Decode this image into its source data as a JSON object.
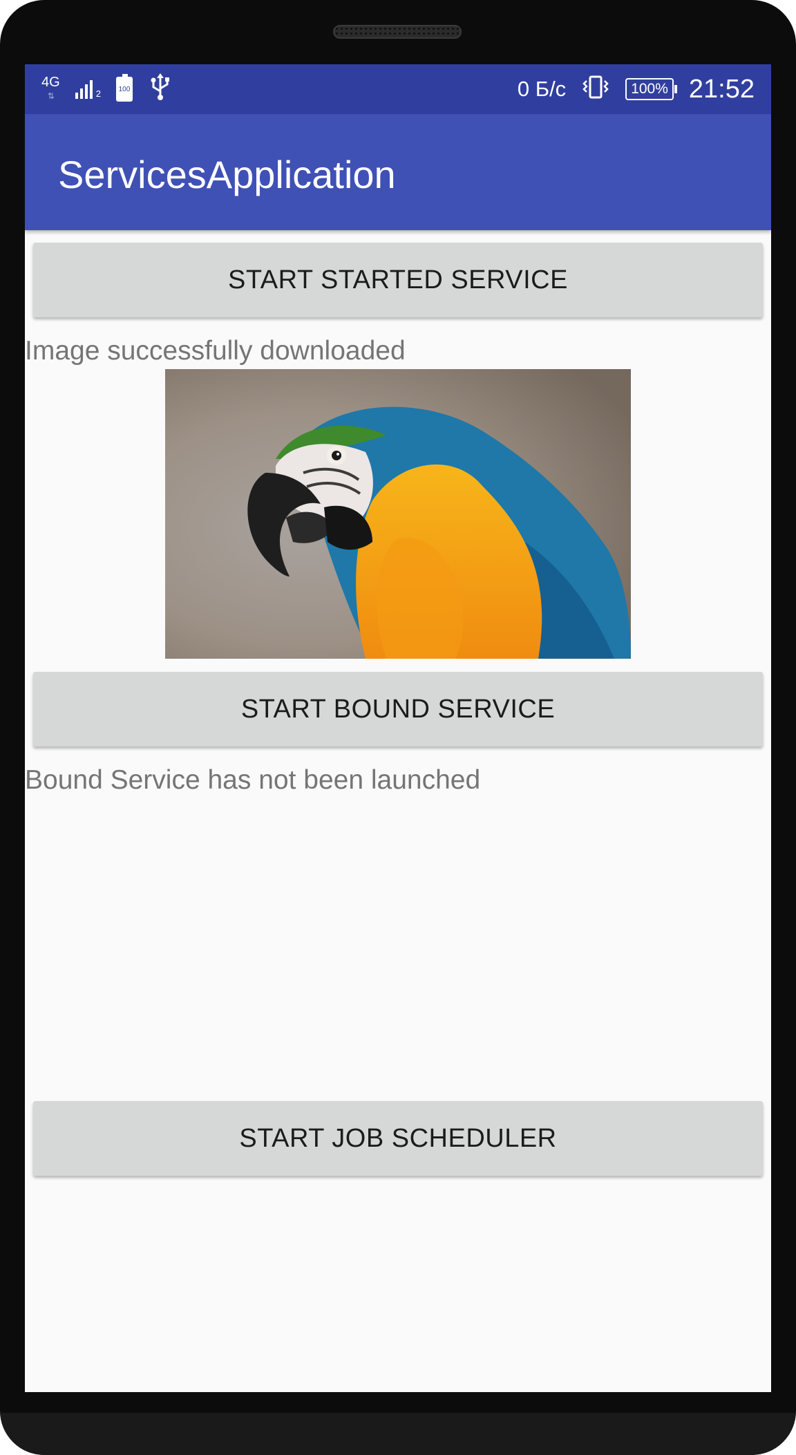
{
  "status_bar": {
    "network_type": "4G",
    "network_arrows": "⇅",
    "signal_sub": "2",
    "battery_small_level": "100",
    "usb_icon": "usb-icon",
    "data_speed": "0 Б/с",
    "vibrate_icon": "vibrate-icon",
    "battery_percent": "100%",
    "time": "21:52"
  },
  "app_bar": {
    "title": "ServicesApplication"
  },
  "main": {
    "start_started_label": "START STARTED SERVICE",
    "started_status": "Image successfully downloaded",
    "start_bound_label": "START BOUND SERVICE",
    "bound_status": "Bound Service has not been launched",
    "start_job_label": "START JOB SCHEDULER"
  },
  "colors": {
    "status_bar": "#303f9f",
    "app_bar": "#3f51b5",
    "button": "#d6d7d7",
    "background": "#fafafa",
    "secondary_text": "#757575"
  }
}
